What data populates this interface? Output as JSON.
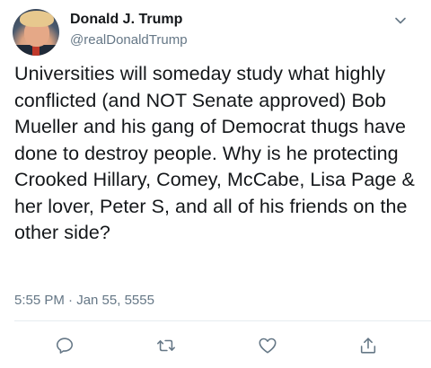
{
  "tweet": {
    "author_name": "Donald J. Trump",
    "author_handle": "@realDonaldTrump",
    "text": "Universities will someday study what highly conflicted (and NOT Senate approved) Bob Mueller and his gang of Democrat thugs have done to destroy people. Why is he protecting Crooked Hillary, Comey, McCabe, Lisa Page & her lover, Peter S, and all of his friends on the other side?",
    "timestamp": "5:55 PM · Jan 55, 5555"
  },
  "icons": {
    "menu": "chevron-down-icon",
    "reply": "reply-icon",
    "retweet": "retweet-icon",
    "like": "heart-icon",
    "share": "share-icon"
  },
  "colors": {
    "text": "#14171a",
    "secondary": "#657786",
    "divider": "#e6ecf0"
  }
}
